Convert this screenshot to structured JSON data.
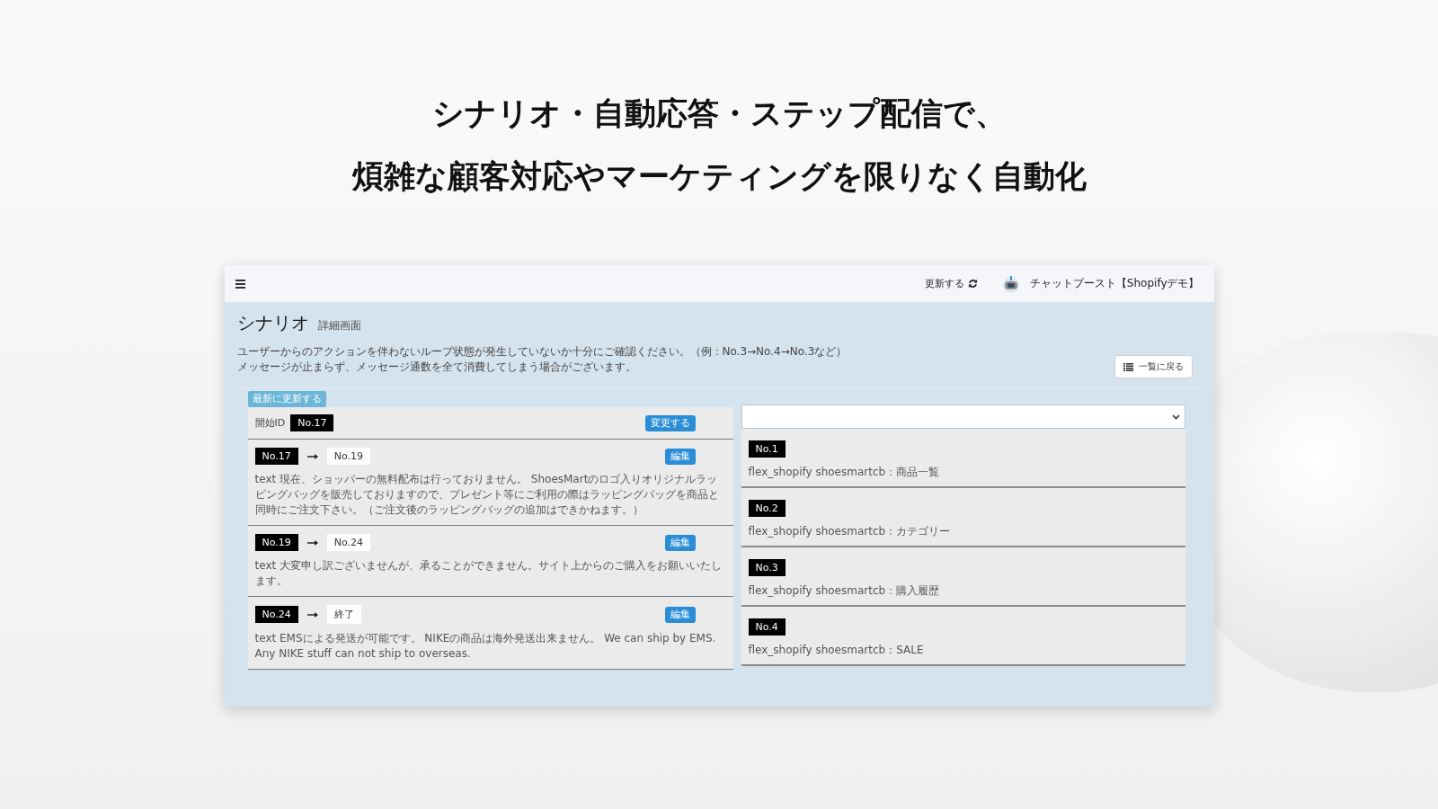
{
  "headline": [
    "シナリオ・自動応答・ステップ配信で、",
    "煩雑な顧客対応やマーケティングを限りなく自動化"
  ],
  "topbar": {
    "refresh": "更新する",
    "account": "チャットブースト【Shopifyデモ】"
  },
  "page": {
    "title": "シナリオ",
    "subtitle": "詳細画面",
    "notes": [
      "ユーザーからのアクションを伴わないループ状態が発生していないか十分にご確認ください。（例：No.3→No.4→No.3など）",
      "メッセージが止まらず、メッセージ通数を全て消費してしまう場合がございます。"
    ],
    "back_button": "一覧に戻る"
  },
  "scenario": {
    "update_button": "最新に更新する",
    "start_label": "開始ID",
    "start_id": "No.17",
    "change_button": "変更する",
    "steps": [
      {
        "from": "No.17",
        "to": "No.19",
        "edit": "編集",
        "text": "text 現在、ショッパーの無料配布は行っておりません。 ShoesMartのロゴ入りオリジナルラッピングバッグを販売しておりますので、プレゼント等にご利用の際はラッピングバッグを商品と同時にご注文下さい。（ご注文後のラッピングバッグの追加はできかねます。）"
      },
      {
        "from": "No.19",
        "to": "No.24",
        "edit": "編集",
        "text": "text 大変申し訳ございませんが、承ることができません。サイト上からのご購入をお願いいたします。"
      },
      {
        "from": "No.24",
        "to": "終了",
        "edit": "編集",
        "text": "text EMSによる発送が可能です。 NIKEの商品は海外発送出来ません。 We can ship by EMS. Any NIKE stuff can not ship to overseas."
      }
    ]
  },
  "nodes": [
    {
      "id": "No.1",
      "text": "flex_shopify shoesmartcb：商品一覧"
    },
    {
      "id": "No.2",
      "text": "flex_shopify shoesmartcb：カテゴリー"
    },
    {
      "id": "No.3",
      "text": "flex_shopify shoesmartcb：購入履歴"
    },
    {
      "id": "No.4",
      "text": "flex_shopify shoesmartcb：SALE"
    }
  ]
}
